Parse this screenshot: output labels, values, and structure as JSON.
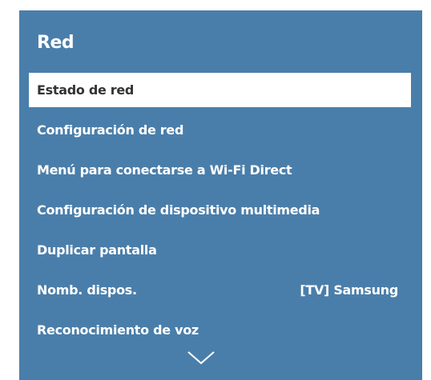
{
  "menu": {
    "title": "Red",
    "items": [
      {
        "label": "Estado de red",
        "value": ""
      },
      {
        "label": "Configuración de red",
        "value": ""
      },
      {
        "label": "Menú para conectarse a Wi-Fi Direct",
        "value": ""
      },
      {
        "label": "Configuración de dispositivo multimedia",
        "value": ""
      },
      {
        "label": "Duplicar pantalla",
        "value": ""
      },
      {
        "label": "Nomb. dispos.",
        "value": "[TV] Samsung"
      },
      {
        "label": "Reconocimiento de voz",
        "value": ""
      }
    ],
    "selected_index": 0
  },
  "icons": {
    "scroll": "chevron-down-icon"
  },
  "colors": {
    "panel_background": "#4a7eaa",
    "selected_background": "#ffffff",
    "text": "#ffffff",
    "selected_text": "#333333"
  }
}
